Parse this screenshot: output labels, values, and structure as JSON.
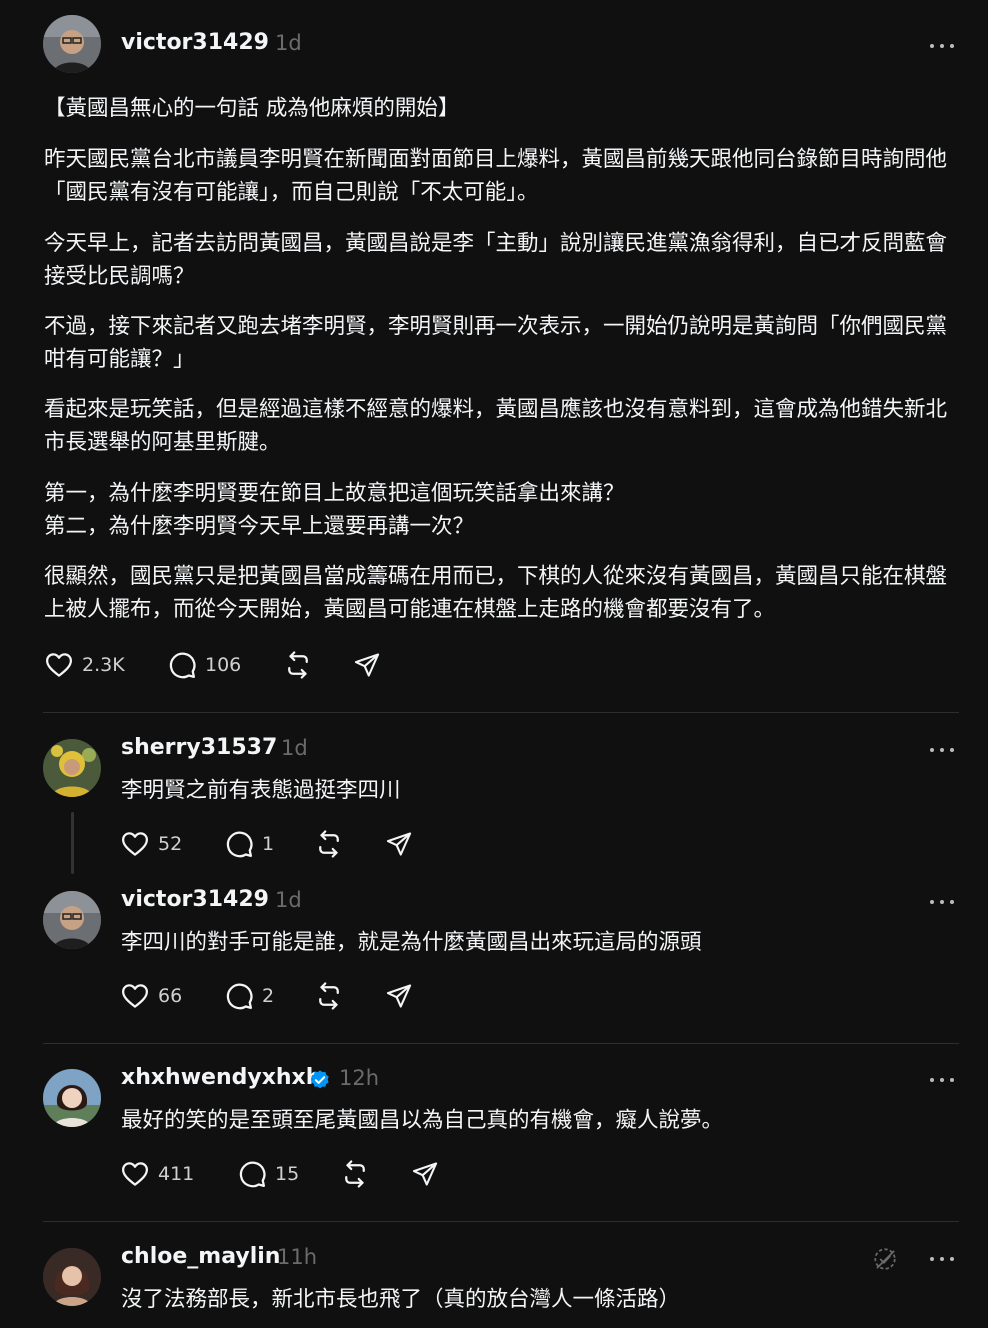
{
  "post": {
    "username": "victor31429",
    "time": "1d",
    "paragraphs": [
      "【黃國昌無心的一句話 成為他麻煩的開始】",
      "昨天國民黨台北市議員李明賢在新聞面對面節目上爆料，黃國昌前幾天跟他同台錄節目時詢問他「國民黨有沒有可能讓」，而自己則說「不太可能」。",
      "今天早上，記者去訪問黃國昌，黃國昌說是李「主動」說別讓民進黨漁翁得利，自已才反問藍會接受比民調嗎？",
      "不過，接下來記者又跑去堵李明賢，李明賢則再一次表示，一開始仍說明是黃詢問「你們國民黨咁有可能讓？」",
      "看起來是玩笑話，但是經過這樣不經意的爆料，黃國昌應該也沒有意料到，這會成為他錯失新北市長選舉的阿基里斯腱。",
      "第一，為什麼李明賢要在節目上故意把這個玩笑話拿出來講？",
      "第二，為什麼李明賢今天早上還要再講一次？",
      "很顯然，國民黨只是把黃國昌當成籌碼在用而已，下棋的人從來沒有黃國昌，黃國昌只能在棋盤上被人擺布，而從今天開始，黃國昌可能連在棋盤上走路的機會都要沒有了。"
    ],
    "likes": "2.3K",
    "comments": "106"
  },
  "replies": [
    {
      "username": "sherry31537",
      "time": "1d",
      "text": "李明賢之前有表態過挺李四川",
      "likes": "52",
      "comments": "1"
    },
    {
      "username": "victor31429",
      "time": "1d",
      "text": "李四川的對手可能是誰，就是為什麼黃國昌出來玩這局的源頭",
      "likes": "66",
      "comments": "2"
    },
    {
      "username": "xhxhwendyxhxh",
      "time": "12h",
      "text": "最好的笑的是至頭至尾黃國昌以為自己真的有機會，癡人說夢。",
      "likes": "411",
      "comments": "15",
      "verified": true
    },
    {
      "username": "chloe_maylin",
      "time": "11h",
      "text": "沒了法務部長，新北市長也飛了（真的放台灣人一條活路）"
    }
  ],
  "colors": {
    "background": "#101010",
    "text": "#f3f5f7",
    "muted": "#6b6b6b",
    "verified": "#0095f6"
  }
}
